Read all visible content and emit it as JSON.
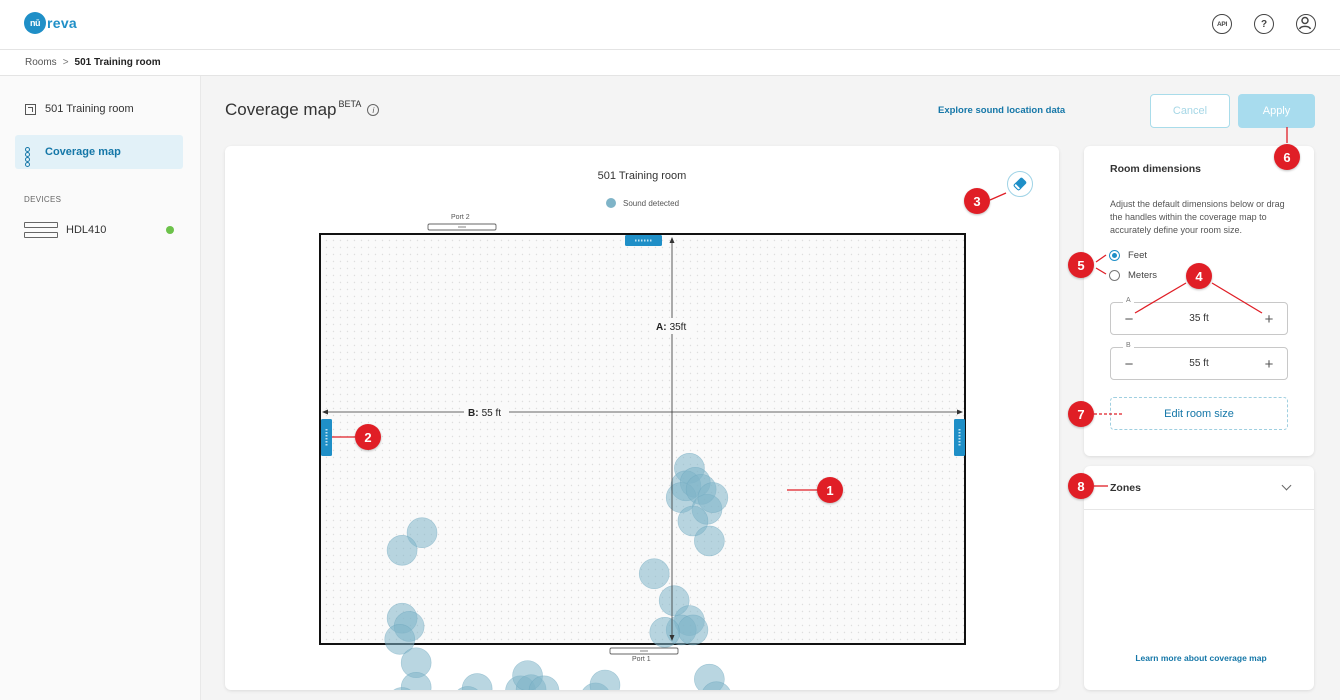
{
  "header": {
    "logo": "nūreva",
    "icons": [
      "api-icon",
      "help-icon",
      "account-icon"
    ],
    "api_label": "API",
    "help_label": "?"
  },
  "breadcrumb": {
    "parent": "Rooms",
    "current": "501 Training room"
  },
  "sidebar": {
    "items": [
      {
        "label": "501 Training room",
        "icon": "room-icon",
        "active": false
      },
      {
        "label": "Coverage map",
        "icon": "grid-icon",
        "active": true
      }
    ],
    "devices_label": "DEVICES",
    "device": {
      "name": "HDL410",
      "status_color": "#6cc24a"
    }
  },
  "page": {
    "title": "Coverage map",
    "title_sup": "BETA",
    "explore_link": "Explore sound location data",
    "cancel_label": "Cancel",
    "apply_label": "Apply"
  },
  "map": {
    "title": "501 Training room",
    "legend_label": "Sound detected",
    "port_top": "Port 2",
    "port_bottom": "Port 1",
    "dim_a_label": "A:",
    "dim_a_value": "35ft",
    "dim_b_label": "B:",
    "dim_b_value": "55 ft",
    "sound_points_ft": [
      [
        31.5,
        20
      ],
      [
        31.2,
        21.5
      ],
      [
        32.0,
        21.2
      ],
      [
        30.8,
        22.5
      ],
      [
        32.5,
        21.8
      ],
      [
        33.0,
        23.5
      ],
      [
        31.8,
        24.5
      ],
      [
        33.5,
        22.5
      ],
      [
        33.2,
        26.2
      ],
      [
        28.5,
        29.0
      ],
      [
        30.2,
        31.3
      ],
      [
        31.5,
        33.0
      ],
      [
        30.8,
        33.8
      ],
      [
        31.8,
        33.8
      ],
      [
        29.4,
        34.0
      ],
      [
        33.2,
        38.0
      ],
      [
        33.8,
        39.5
      ],
      [
        8.7,
        25.5
      ],
      [
        7.0,
        27.0
      ],
      [
        7.0,
        32.8
      ],
      [
        7.6,
        33.5
      ],
      [
        6.8,
        34.6
      ],
      [
        8.2,
        36.6
      ],
      [
        8.2,
        38.7
      ],
      [
        7.0,
        40.0
      ],
      [
        12.6,
        39.9
      ],
      [
        13.4,
        38.8
      ],
      [
        17.1,
        39.0
      ],
      [
        18.0,
        38.9
      ],
      [
        17.7,
        37.7
      ],
      [
        19.1,
        39.0
      ],
      [
        23.5,
        39.6
      ],
      [
        24.3,
        38.5
      ]
    ],
    "sound_color": "#7fb4c8"
  },
  "room_dimensions": {
    "title": "Room dimensions",
    "description": "Adjust the default dimensions below or drag the handles within the coverage map to accurately define your room size.",
    "unit_feet": "Feet",
    "unit_meters": "Meters",
    "selected_unit": "Feet",
    "a_label": "A",
    "a_value": "35 ft",
    "b_label": "B",
    "b_value": "55 ft",
    "minus": "−",
    "plus": "+",
    "edit_button": "Edit room size"
  },
  "zones": {
    "label": "Zones",
    "learn_link": "Learn more about coverage map"
  },
  "annotations": [
    "1",
    "2",
    "3",
    "4",
    "5",
    "6",
    "7",
    "8"
  ],
  "colors": {
    "accent": "#1f8fc7",
    "badge": "#e01e26",
    "sound": "#7fb4c8"
  }
}
